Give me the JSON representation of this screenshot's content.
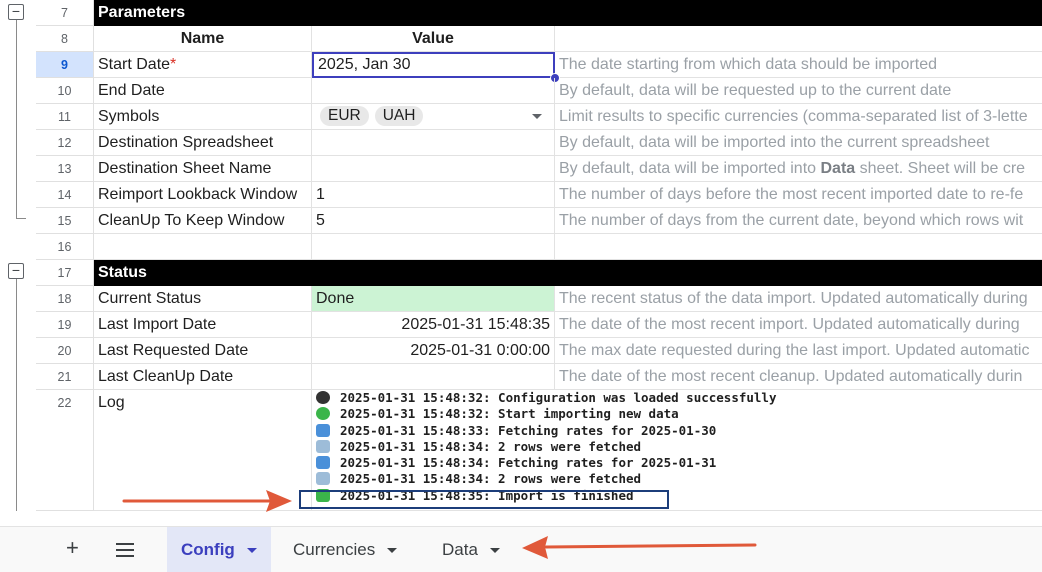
{
  "rows": {
    "r7": {
      "num": "7",
      "header": "Parameters"
    },
    "r8": {
      "num": "8",
      "name_col": "Name",
      "value_col": "Value"
    },
    "r9": {
      "num": "9",
      "name": "Start Date",
      "required_mark": "*",
      "value": "2025, Jan 30",
      "desc": "The date starting from which data should be imported"
    },
    "r10": {
      "num": "10",
      "name": "End Date",
      "value": "",
      "desc": "By default, data will be requested up to the current date"
    },
    "r11": {
      "num": "11",
      "name": "Symbols",
      "chips": [
        "EUR",
        "UAH"
      ],
      "desc": "Limit results to specific currencies (comma-separated list of 3-lette"
    },
    "r12": {
      "num": "12",
      "name": "Destination Spreadsheet",
      "value": "",
      "desc": "By default, data will be imported into the current spreadsheet"
    },
    "r13": {
      "num": "13",
      "name": "Destination Sheet Name",
      "value": "",
      "desc_pre": "By default, data will be imported into ",
      "desc_bold": "Data",
      "desc_post": " sheet. Sheet will be cre"
    },
    "r14": {
      "num": "14",
      "name": "Reimport Lookback Window",
      "value": "1",
      "desc": "The number of days before the most recent imported date to re-fe"
    },
    "r15": {
      "num": "15",
      "name": "CleanUp To Keep Window",
      "value": "5",
      "desc": "The number of days from the current date, beyond which rows wit"
    },
    "r16": {
      "num": "16"
    },
    "r17": {
      "num": "17",
      "header": "Status"
    },
    "r18": {
      "num": "18",
      "name": "Current Status",
      "value": "Done",
      "desc": "The recent status of the data import. Updated automatically during"
    },
    "r19": {
      "num": "19",
      "name": "Last Import Date",
      "value": "2025-01-31 15:48:35",
      "desc": "The date of the most recent import. Updated automatically during"
    },
    "r20": {
      "num": "20",
      "name": "Last Requested Date",
      "value": "2025-01-31 0:00:00",
      "desc": "The max date requested during the last import. Updated automatic"
    },
    "r21": {
      "num": "21",
      "name": "Last CleanUp Date",
      "value": "",
      "desc": "The date of the most recent cleanup. Updated automatically durin"
    },
    "r22": {
      "num": "22",
      "name": "Log"
    }
  },
  "log": [
    {
      "icon": "black-circle-icon",
      "text": "2025-01-31 15:48:32: Configuration was loaded successfully"
    },
    {
      "icon": "green-circle-icon",
      "text": "2025-01-31 15:48:32: Start importing new data"
    },
    {
      "icon": "refresh-icon",
      "text": "2025-01-31 15:48:33: Fetching rates for 2025-01-30"
    },
    {
      "icon": "checkbox-icon",
      "text": "2025-01-31 15:48:34: 2 rows were fetched"
    },
    {
      "icon": "refresh-icon",
      "text": "2025-01-31 15:48:34: Fetching rates for 2025-01-31"
    },
    {
      "icon": "checkbox-icon",
      "text": "2025-01-31 15:48:34: 2 rows were fetched"
    },
    {
      "icon": "check-mark-icon",
      "text": "2025-01-31 15:48:35: Import is finished"
    }
  ],
  "sheet_tabs": {
    "add_label": "+",
    "tabs": [
      "Config",
      "Currencies",
      "Data"
    ],
    "active": "Config"
  },
  "colors": {
    "accent": "#3b3fbe",
    "header_bg": "#000000",
    "done_bg": "#ccf3d4",
    "annotation_arrow": "#e0593a"
  }
}
